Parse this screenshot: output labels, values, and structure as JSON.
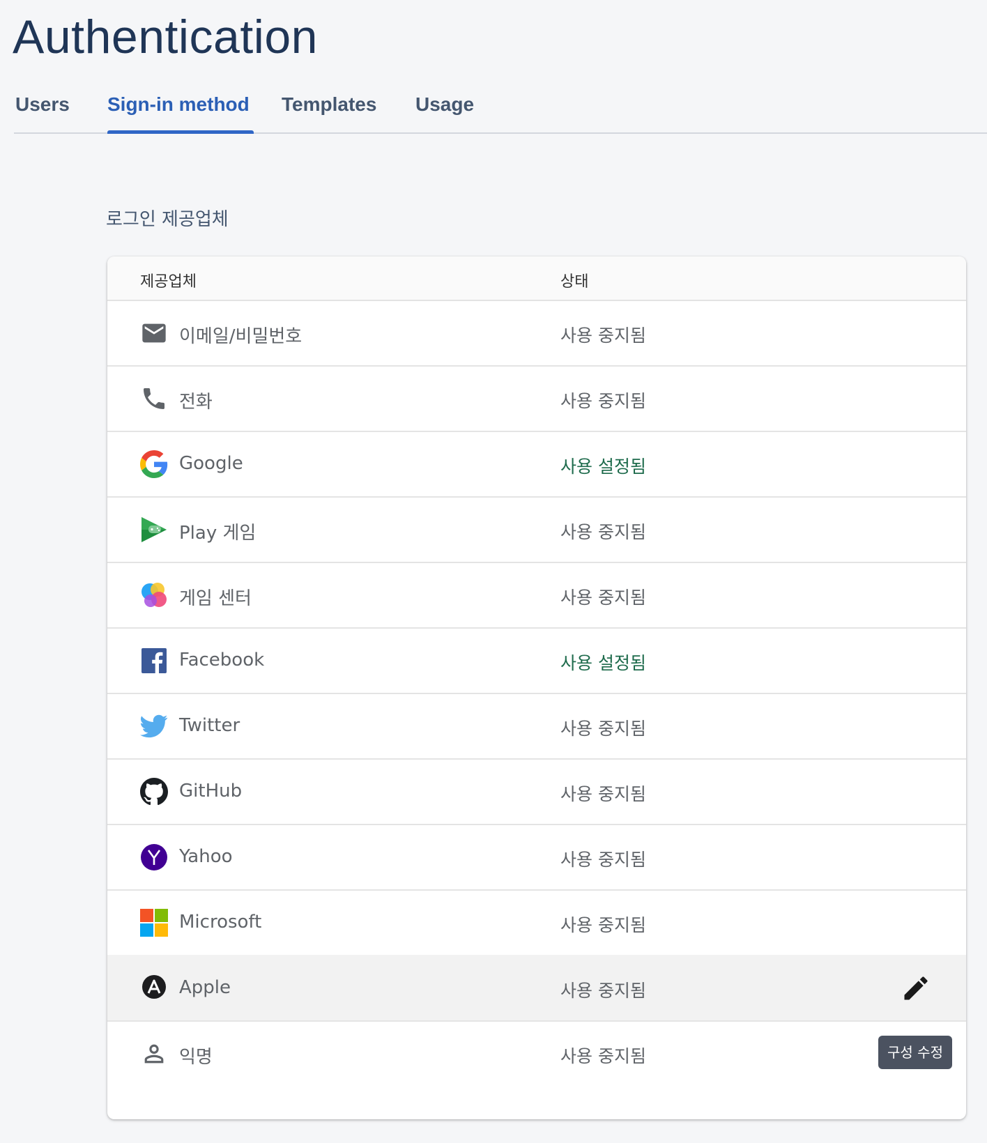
{
  "page": {
    "title": "Authentication"
  },
  "tabs": [
    {
      "label": "Users"
    },
    {
      "label": "Sign-in method"
    },
    {
      "label": "Templates"
    },
    {
      "label": "Usage"
    }
  ],
  "section": {
    "title": "로그인 제공업체"
  },
  "table": {
    "headers": {
      "provider": "제공업체",
      "status": "상태"
    },
    "rows": [
      {
        "name": "이메일/비밀번호",
        "status": "사용 중지됨",
        "icon": "email-icon"
      },
      {
        "name": "전화",
        "status": "사용 중지됨",
        "icon": "phone-icon"
      },
      {
        "name": "Google",
        "status": "사용 설정됨",
        "icon": "google-icon"
      },
      {
        "name": "Play 게임",
        "status": "사용 중지됨",
        "icon": "play-games-icon"
      },
      {
        "name": "게임 센터",
        "status": "사용 중지됨",
        "icon": "game-center-icon"
      },
      {
        "name": "Facebook",
        "status": "사용 설정됨",
        "icon": "facebook-icon"
      },
      {
        "name": "Twitter",
        "status": "사용 중지됨",
        "icon": "twitter-icon"
      },
      {
        "name": "GitHub",
        "status": "사용 중지됨",
        "icon": "github-icon"
      },
      {
        "name": "Yahoo",
        "status": "사용 중지됨",
        "icon": "yahoo-icon"
      },
      {
        "name": "Microsoft",
        "status": "사용 중지됨",
        "icon": "microsoft-icon"
      },
      {
        "name": "Apple",
        "status": "사용 중지됨",
        "icon": "apple-icon"
      },
      {
        "name": "익명",
        "status": "사용 중지됨",
        "icon": "anonymous-icon"
      }
    ]
  },
  "tooltip": {
    "text": "구성 수정"
  },
  "colors": {
    "accent": "#2f66c6",
    "enabled": "#1e6b4c",
    "title": "#1f3556"
  }
}
